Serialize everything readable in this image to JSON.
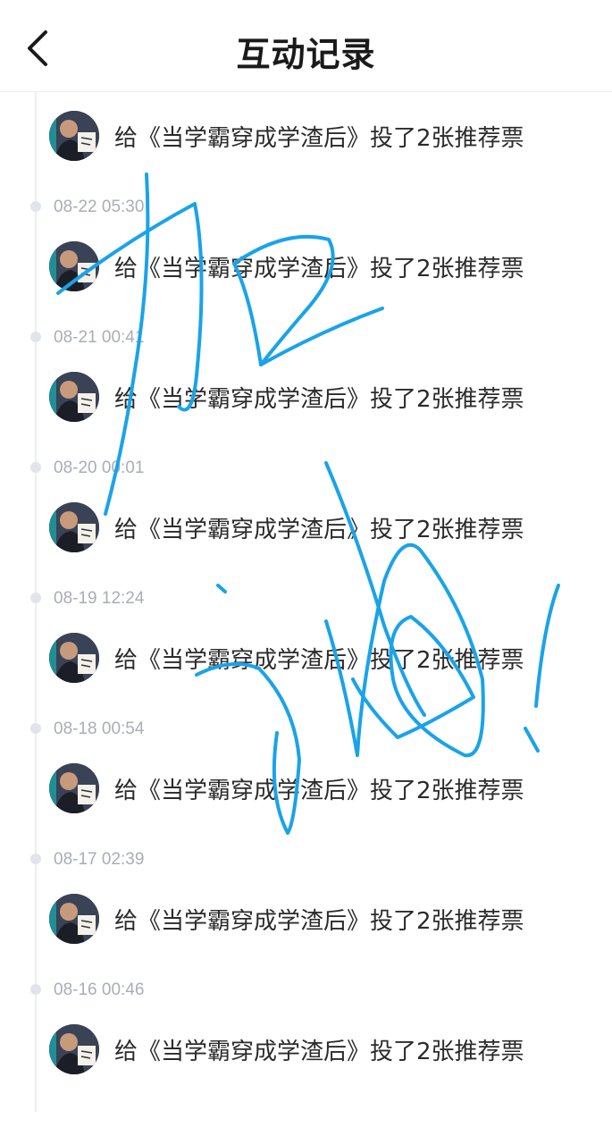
{
  "header": {
    "title": "互动记录",
    "back_icon": "chevron-left-icon"
  },
  "entries": [
    {
      "time": "",
      "text": "给《当学霸穿成学渣后》投了2张推荐票"
    },
    {
      "time": "08-22 05:30",
      "text": "给《当学霸穿成学渣后》投了2张推荐票"
    },
    {
      "time": "08-21 00:41",
      "text": "给《当学霸穿成学渣后》投了2张推荐票"
    },
    {
      "time": "08-20 00:01",
      "text": "给《当学霸穿成学渣后》投了2张推荐票"
    },
    {
      "time": "08-19 12:24",
      "text": "给《当学霸穿成学渣后》投了2张推荐票"
    },
    {
      "time": "08-18 00:54",
      "text": "给《当学霸穿成学渣后》投了2张推荐票"
    },
    {
      "time": "08-17 02:39",
      "text": "给《当学霸穿成学渣后》投了2张推荐票"
    },
    {
      "time": "08-16 00:46",
      "text": "给《当学霸穿成学渣后》投了2张推荐票"
    }
  ],
  "colors": {
    "accent_scribble": "#1aa3e8",
    "timeline": "#eceef2",
    "time_text": "#a9adb6"
  }
}
